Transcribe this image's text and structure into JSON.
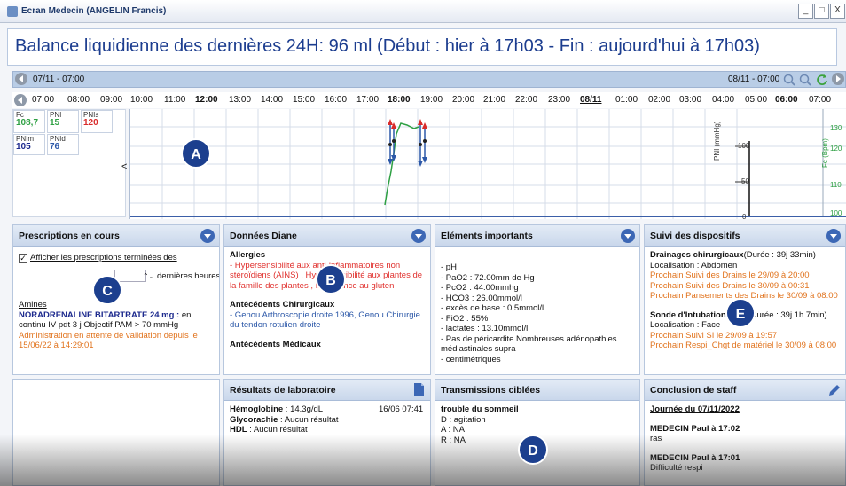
{
  "window": {
    "title": "Ecran Medecin (ANGELIN Francis)",
    "minimize": "_",
    "maximize": "□",
    "close": "X"
  },
  "headline": "Balance liquidienne des dernières 24H: 96 ml (Début : hier à 17h03 - Fin : aujourd'hui à 17h03)",
  "timeline": {
    "range_start": "07/11 - 07:00",
    "range_end": "08/11 - 07:00",
    "hours": [
      "07:00",
      "08:00",
      "09:00",
      "10:00",
      "11:00",
      "12:00",
      "13:00",
      "14:00",
      "15:00",
      "16:00",
      "17:00",
      "18:00",
      "19:00",
      "20:00",
      "21:00",
      "22:00",
      "23:00",
      "08/11",
      "01:00",
      "02:00",
      "03:00",
      "04:00",
      "05:00",
      "06:00",
      "07:00"
    ]
  },
  "vitals": {
    "fc": {
      "label": "Fc",
      "value": "108,7"
    },
    "pni": {
      "label": "PNI",
      "value": "15"
    },
    "pnis": {
      "label": "PNIs",
      "value": "120"
    },
    "pnim": {
      "label": "PNIm",
      "value": "105"
    },
    "pnid": {
      "label": "PNId",
      "value": "76"
    },
    "expand": "<"
  },
  "chart_data": {
    "type": "line",
    "right_axes": [
      {
        "label": "PNI (mmHg)",
        "ticks": [
          "100",
          "50",
          "0"
        ]
      },
      {
        "label": "Fc (Bpm)",
        "ticks": [
          "130",
          "120",
          "110",
          "100"
        ]
      }
    ]
  },
  "markers": {
    "a": "A",
    "b": "B",
    "c": "C",
    "d": "D",
    "e": "E"
  },
  "prescriptions": {
    "title": "Prescriptions en cours",
    "checkbox_label": "Afficher les prescriptions terminées des",
    "hours_suffix": "dernières heures",
    "category": "Amines",
    "drug": "NORADRENALINE BITARTRATE 24 mg :",
    "drug_detail": " en continu IV pdt 3 j Objectif PAM > 70 mmHg",
    "status": "Administration en attente de validation depuis le 15/06/22 à 14:29:01"
  },
  "donnees": {
    "title": "Données Diane",
    "allergies_title": "Allergies",
    "allergies": "- Hypersensibilité aux anti-inflammatoires non stéroïdiens (AINS) , Hypersensibilité aux plantes de la famille des plantes , Intolérance au gluten",
    "chir_title": "Antécédents Chirurgicaux",
    "chir": "- Genou Arthroscopie droite 1996, Genou Chirurgie du tendon rotulien droite",
    "medic_title": "Antécédents Médicaux"
  },
  "elements": {
    "title": "Eléments importants",
    "lines": [
      "- pH",
      "- PaO2 : 72.00mm de Hg",
      "- PcO2 : 44.00mmhg",
      "- HCO3 : 26.00mmol/l",
      "- excès de base : 0.5mmol/l",
      "- FiO2 : 55%",
      "- lactates : 13.10mmol/l",
      "- Pas de péricardite Nombreuses adénopathies médiastinales supra",
      "- centimétriques"
    ]
  },
  "suivi": {
    "title": "Suivi des dispositifs",
    "drain_title": "Drainages chirurgicaux",
    "drain_duration": "(Durée : 39j 33min)",
    "drain_loc": "Localisation : Abdomen",
    "drain_next": [
      "Prochain Suivi des Drains le 29/09 à 20:00",
      "Prochain Suivi des Drains le 30/09 à 00:31",
      "Prochain Pansements des Drains le 30/09 à 08:00"
    ],
    "sonde_title": "Sonde d'Intubation (IOT)",
    "sonde_duration": "(Durée : 39j 1h 7min)",
    "sonde_loc": "Localisation : Face",
    "sonde_next": [
      "Prochain Suivi SI le 29/09 à 19:57",
      "Prochain Respi_Chgt de matériel le 30/09 à 08:00"
    ]
  },
  "labo": {
    "title": "Résultats de laboratoire",
    "rows": [
      {
        "name": "Hémoglobine",
        "value": " : 14.3g/dL",
        "date": "16/06 07:41"
      },
      {
        "name": "Glycorachie",
        "value": " : Aucun résultat",
        "date": ""
      },
      {
        "name": "HDL",
        "value": " : Aucun résultat",
        "date": ""
      }
    ]
  },
  "transmissions": {
    "title": "Transmissions ciblées",
    "topic": "trouble du sommeil",
    "lines": [
      "D : agitation",
      "A : NA",
      "R : NA"
    ]
  },
  "conclusion": {
    "title": "Conclusion de staff",
    "date": "Journée du 07/11/2022",
    "entries": [
      {
        "author": "MEDECIN Paul à 17:02",
        "text": "ras"
      },
      {
        "author": "MEDECIN Paul à 17:01",
        "text": "Difficulté respi"
      }
    ]
  }
}
